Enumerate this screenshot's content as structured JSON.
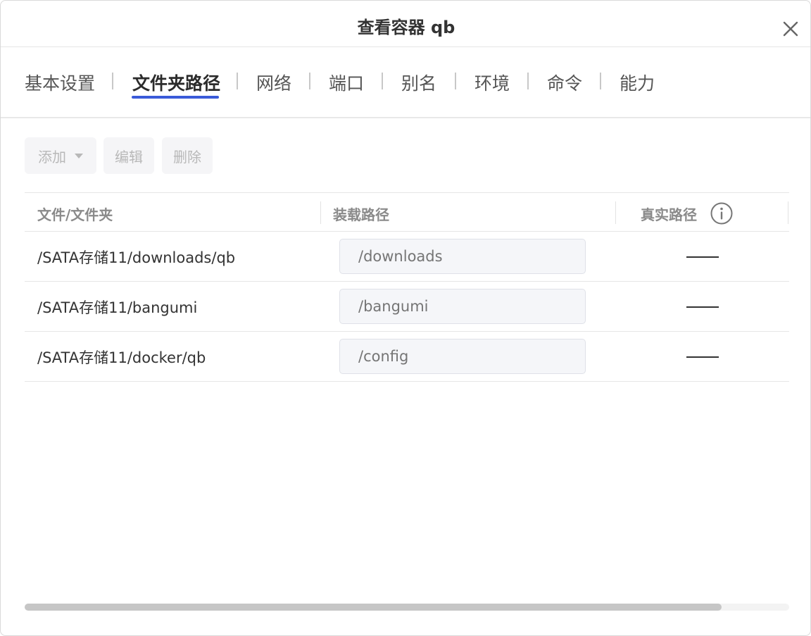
{
  "dialog": {
    "title": "查看容器 qb",
    "close_icon": "close-icon"
  },
  "tabs": [
    {
      "label": "基本设置",
      "active": false
    },
    {
      "label": "文件夹路径",
      "active": true
    },
    {
      "label": "网络",
      "active": false
    },
    {
      "label": "端口",
      "active": false
    },
    {
      "label": "别名",
      "active": false
    },
    {
      "label": "环境",
      "active": false
    },
    {
      "label": "命令",
      "active": false
    },
    {
      "label": "能力",
      "active": false
    }
  ],
  "toolbar": {
    "add_label": "添加",
    "edit_label": "编辑",
    "delete_label": "删除"
  },
  "table": {
    "headers": [
      "文件/文件夹",
      "装载路径",
      "真实路径"
    ],
    "info_icon": "info-icon",
    "rows": [
      {
        "path": "/SATA存储11/downloads/qb",
        "mount_placeholder": "/downloads",
        "real_path": "——"
      },
      {
        "path": "/SATA存储11/bangumi",
        "mount_placeholder": "/bangumi",
        "real_path": "——"
      },
      {
        "path": "/SATA存储11/docker/qb",
        "mount_placeholder": "/config",
        "real_path": "——"
      }
    ]
  },
  "colors": {
    "accent": "#3a5bd9",
    "disabled_text": "#b8b8b8"
  }
}
